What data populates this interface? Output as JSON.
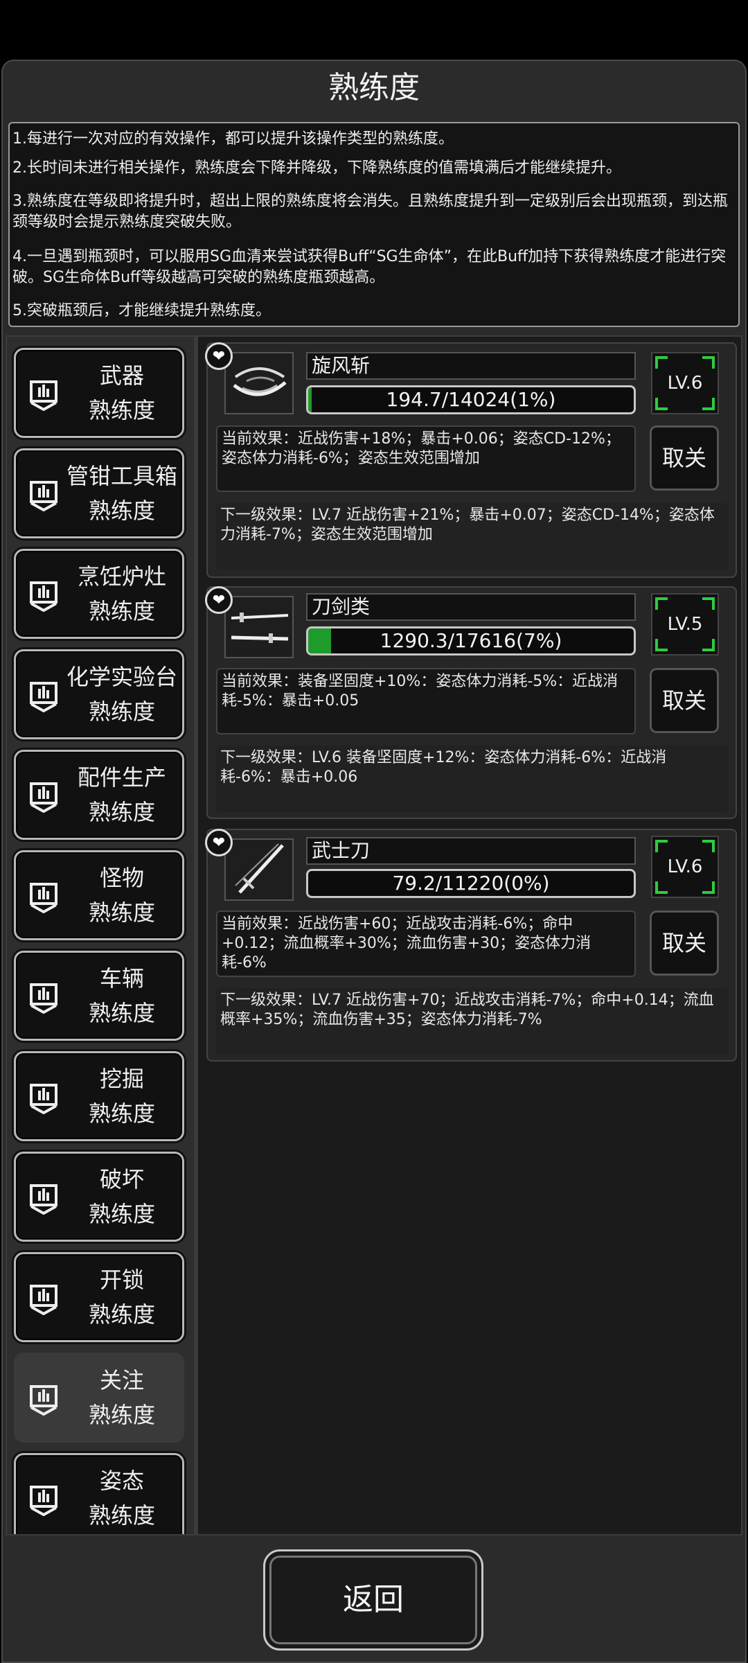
{
  "header": {
    "title": "熟练度"
  },
  "rules": [
    "1.每进行一次对应的有效操作，都可以提升该操作类型的熟练度。",
    "2.长时间未进行相关操作，熟练度会下降并降级，下降熟练度的值需填满后才能继续提升。",
    "3.熟练度在等级即将提升时，超出上限的熟练度将会消失。且熟练度提升到一定级别后会出现瓶颈，到达瓶颈等级时会提示熟练度突破失败。",
    "4.一旦遇到瓶颈时，可以服用SG血清来尝试获得Buff“SG生命体”，在此Buff加持下获得熟练度才能进行突破。SG生命体Buff等级越高可突破的熟练度瓶颈越高。",
    "5.突破瓶颈后，才能继续提升熟练度。"
  ],
  "sidebar": {
    "items": [
      {
        "line1": "武器",
        "line2": "熟练度"
      },
      {
        "line1": "管钳工具箱",
        "line2": "熟练度"
      },
      {
        "line1": "烹饪炉灶",
        "line2": "熟练度"
      },
      {
        "line1": "化学实验台",
        "line2": "熟练度"
      },
      {
        "line1": "配件生产",
        "line2": "熟练度"
      },
      {
        "line1": "怪物",
        "line2": "熟练度"
      },
      {
        "line1": "车辆",
        "line2": "熟练度"
      },
      {
        "line1": "挖掘",
        "line2": "熟练度"
      },
      {
        "line1": "破坏",
        "line2": "熟练度"
      },
      {
        "line1": "开锁",
        "line2": "熟练度"
      },
      {
        "line1": "关注",
        "line2": "熟练度"
      },
      {
        "line1": "姿态",
        "line2": "熟练度"
      }
    ],
    "active_index": 10
  },
  "cards": [
    {
      "name": "旋风斩",
      "progress_text": "194.7/14024(1%)",
      "progress": 0.01,
      "level": "LV.6",
      "current_effect": "当前效果：近战伤害+18%；暴击+0.06；姿态CD-12%；姿态体力消耗-6%；姿态生效范围增加",
      "cancel_label": "取关",
      "next_effect": "下一级效果：LV.7 近战伤害+21%；暴击+0.07；姿态CD-14%；姿态体力消耗-7%；姿态生效范围增加",
      "icon": "whirlwind-icon"
    },
    {
      "name": "刀剑类",
      "progress_text": "1290.3/17616(7%)",
      "progress": 0.07,
      "level": "LV.5",
      "current_effect": "当前效果：装备坚固度+10%：姿态体力消耗-5%：近战消耗-5%：暴击+0.05",
      "cancel_label": "取关",
      "next_effect": "下一级效果：LV.6 装备坚固度+12%：姿态体力消耗-6%：近战消耗-6%：暴击+0.06",
      "icon": "swords-icon"
    },
    {
      "name": "武士刀",
      "progress_text": "79.2/11220(0%)",
      "progress": 0.0,
      "level": "LV.6",
      "current_effect": "当前效果：近战伤害+60；近战攻击消耗-6%；命中+0.12；流血概率+30%；流血伤害+30；姿态体力消耗-6%",
      "cancel_label": "取关",
      "next_effect": "下一级效果：LV.7 近战伤害+70；近战攻击消耗-7%；命中+0.14；流血概率+35%；流血伤害+35；姿态体力消耗-7%",
      "icon": "katana-icon"
    }
  ],
  "footer": {
    "back_label": "返回"
  },
  "colors": {
    "progress": "#1f9b2b",
    "level_corner": "#2ecc40",
    "panel": "#2b2b2b"
  }
}
